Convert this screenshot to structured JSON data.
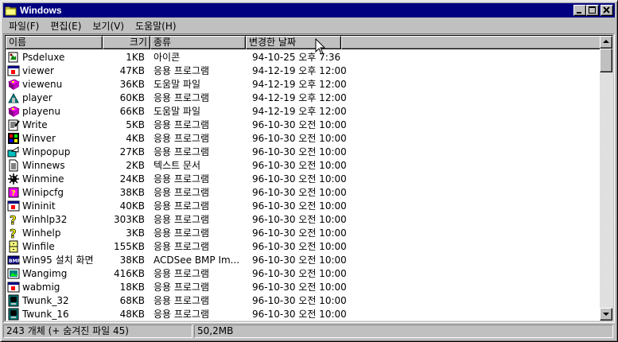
{
  "window": {
    "title": "Windows",
    "icon": "folder-icon"
  },
  "menu": [
    "파일(F)",
    "편집(E)",
    "보기(V)",
    "도움말(H)"
  ],
  "columns": {
    "name": "이름",
    "size": "크기",
    "type": "종류",
    "date": "변경한 날짜"
  },
  "files": [
    {
      "name": "Psdeluxe",
      "size": "1KB",
      "type": "아이콘",
      "date": "94-10-25 오후 7:36",
      "icon": "icon-file-icon"
    },
    {
      "name": "viewer",
      "size": "47KB",
      "type": "응용 프로그램",
      "date": "94-12-19 오후 12:00",
      "icon": "app-window-icon"
    },
    {
      "name": "viewenu",
      "size": "36KB",
      "type": "도움말 파일",
      "date": "94-12-19 오후 12:00",
      "icon": "help-book-icon"
    },
    {
      "name": "player",
      "size": "60KB",
      "type": "응용 프로그램",
      "date": "94-12-19 오후 12:00",
      "icon": "player-app-icon"
    },
    {
      "name": "playenu",
      "size": "66KB",
      "type": "도움말 파일",
      "date": "94-12-19 오후 12:00",
      "icon": "help-book-icon"
    },
    {
      "name": "Write",
      "size": "5KB",
      "type": "응용 프로그램",
      "date": "96-10-30 오전 10:00",
      "icon": "write-app-icon"
    },
    {
      "name": "Winver",
      "size": "4KB",
      "type": "응용 프로그램",
      "date": "96-10-30 오전 10:00",
      "icon": "windows-app-icon"
    },
    {
      "name": "Winpopup",
      "size": "27KB",
      "type": "응용 프로그램",
      "date": "96-10-30 오전 10:00",
      "icon": "popup-app-icon"
    },
    {
      "name": "Winnews",
      "size": "2KB",
      "type": "텍스트 문서",
      "date": "96-10-30 오전 10:00",
      "icon": "text-document-icon"
    },
    {
      "name": "Winmine",
      "size": "24KB",
      "type": "응용 프로그램",
      "date": "96-10-30 오전 10:00",
      "icon": "mine-icon"
    },
    {
      "name": "Winipcfg",
      "size": "38KB",
      "type": "응용 프로그램",
      "date": "96-10-30 오전 10:00",
      "icon": "network-config-icon"
    },
    {
      "name": "Wininit",
      "size": "40KB",
      "type": "응용 프로그램",
      "date": "96-10-30 오전 10:00",
      "icon": "app-window-icon"
    },
    {
      "name": "Winhlp32",
      "size": "303KB",
      "type": "응용 프로그램",
      "date": "96-10-30 오전 10:00",
      "icon": "help-question-icon"
    },
    {
      "name": "Winhelp",
      "size": "3KB",
      "type": "응용 프로그램",
      "date": "96-10-30 오전 10:00",
      "icon": "help-question-icon"
    },
    {
      "name": "Winfile",
      "size": "155KB",
      "type": "응용 프로그램",
      "date": "96-10-30 오전 10:00",
      "icon": "file-cabinet-icon"
    },
    {
      "name": "Win95 설치 화면",
      "size": "38KB",
      "type": "ACDSee BMP Im...",
      "date": "96-10-30 오전 10:00",
      "icon": "bmp-image-icon"
    },
    {
      "name": "Wangimg",
      "size": "416KB",
      "type": "응용 프로그램",
      "date": "96-10-30 오전 10:00",
      "icon": "imaging-app-icon"
    },
    {
      "name": "wabmig",
      "size": "18KB",
      "type": "응용 프로그램",
      "date": "96-10-30 오전 10:00",
      "icon": "app-window-icon"
    },
    {
      "name": "Twunk_32",
      "size": "68KB",
      "type": "응용 프로그램",
      "date": "96-10-30 오전 10:00",
      "icon": "twain-app-icon"
    },
    {
      "name": "Twunk_16",
      "size": "48KB",
      "type": "응용 프로그램",
      "date": "96-10-30 오전 10:00",
      "icon": "twain-app-icon"
    }
  ],
  "status": {
    "count": "243 개체 (+ 숨겨진 파일 45)",
    "size": "50,2MB"
  }
}
